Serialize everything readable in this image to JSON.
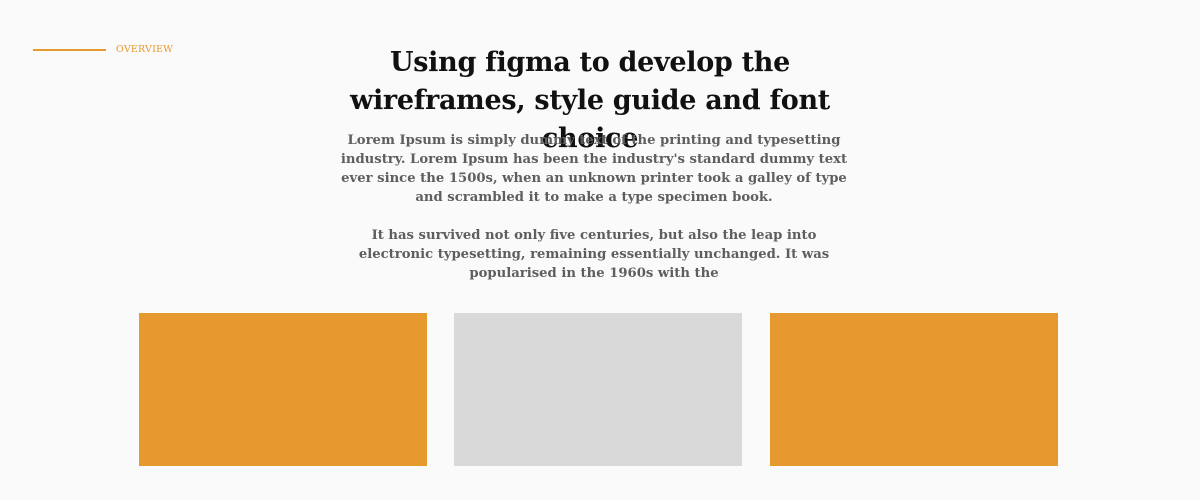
{
  "section": {
    "label": "OVERVIEW"
  },
  "hero": {
    "title": "Using figma to develop the wireframes, style guide and font choice",
    "paragraphs": [
      "Lorem Ipsum is simply dummy text of the printing and typesetting industry. Lorem Ipsum has been the industry's standard dummy text ever since the 1500s, when an unknown printer took a galley of type and scrambled it to make a type specimen book.",
      "It has survived not only five centuries, but also the leap into electronic typesetting, remaining essentially unchanged. It was popularised in the 1960s with the"
    ]
  },
  "colors": {
    "accent": "#e5992f",
    "placeholder_gray": "#d9d9d9",
    "background": "#fafafa",
    "heading": "#111111",
    "body": "#5e5e5e"
  },
  "cards": [
    {
      "color": "#e5992f"
    },
    {
      "color": "#d9d9d9"
    },
    {
      "color": "#e5992f"
    }
  ]
}
